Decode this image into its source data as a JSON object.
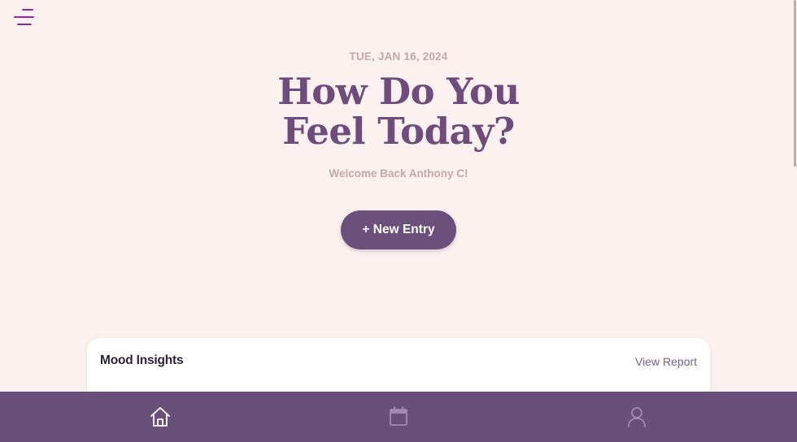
{
  "header": {
    "menu_icon": "menu-icon",
    "date": "TUE, JAN 16, 2024",
    "title": "How Do You Feel Today?",
    "welcome": "Welcome Back Anthony C!"
  },
  "actions": {
    "new_entry_label": "+ New Entry"
  },
  "insights": {
    "title": "Mood Insights",
    "link_label": "View Report"
  },
  "nav": {
    "items": [
      {
        "icon": "home-icon",
        "active": true
      },
      {
        "icon": "calendar-icon",
        "active": false
      },
      {
        "icon": "user-icon",
        "active": false
      }
    ]
  },
  "colors": {
    "background": "#fcf1ee",
    "accent": "#6d4f7c",
    "headline": "#6e4c7e",
    "muted_text": "#c2a9a5",
    "menu_icon": "#8e2a9b"
  }
}
